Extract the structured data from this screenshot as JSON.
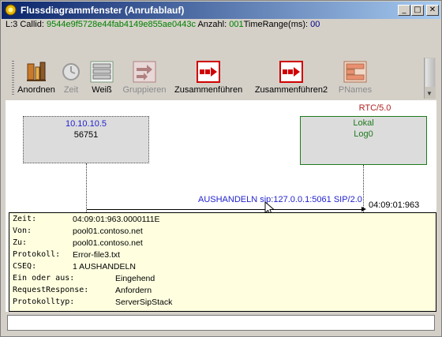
{
  "window": {
    "title": "Flussdiagrammfenster (Anrufablauf)",
    "controls": {
      "minimize": "_",
      "maximize": "□",
      "close": "✕"
    }
  },
  "info": {
    "prefix": "L:3 Callid: ",
    "callid": "9544e9f5728e44fab4149e855ae0443c",
    "count_label": " Anzahl: ",
    "count": "001",
    "time_label": "TimeRange(ms): ",
    "time": "00"
  },
  "toolbar": {
    "items": [
      {
        "label": "Anordnen",
        "icon": "arrange-icon",
        "enabled": true
      },
      {
        "label": "Zeit",
        "icon": "clock-icon",
        "enabled": false
      },
      {
        "label": "Weiß",
        "icon": "white-layout-icon",
        "enabled": true
      },
      {
        "label": "Gruppieren",
        "icon": "group-icon",
        "enabled": false
      },
      {
        "label": "Zusammenführen",
        "icon": "merge-icon",
        "enabled": true
      },
      {
        "label": "Zusammenführen2",
        "icon": "merge2-icon",
        "enabled": true
      },
      {
        "label": "PNames",
        "icon": "pnames-icon",
        "enabled": false
      }
    ]
  },
  "diagram": {
    "rtc_label": "RTC/5.0",
    "left_node": {
      "ip": "10.10.10.5",
      "port": "56751"
    },
    "right_node": {
      "line1": "Lokal",
      "line2": "Log0"
    },
    "message": {
      "label": "AUSHANDELN sip:127.0.0.1:5061 SIP/2.0",
      "time": "04:09:01:963"
    }
  },
  "details": {
    "rows": [
      {
        "key": "Zeit:",
        "value": "04:09:01:963.0000111E"
      },
      {
        "key": "Von:",
        "value": "pool01.contoso.net"
      },
      {
        "key": "Zu:",
        "value": "pool01.contoso.net"
      },
      {
        "key": "Protokoll:",
        "value": "Error-file3.txt"
      },
      {
        "key": "CSEQ:",
        "value": "1 AUSHANDELN"
      },
      {
        "key": "Ein oder aus:",
        "value": "Eingehend"
      },
      {
        "key": "RequestResponse:",
        "value": "Anfordern"
      },
      {
        "key": "Protokolltyp:",
        "value": "ServerSipStack"
      }
    ]
  },
  "colors": {
    "titlebar_start": "#0a246a",
    "callid": "#008000",
    "rtc": "#b22222",
    "message": "#1f1fcf",
    "details_bg": "#ffffe0",
    "right_node_border": "#1f7a1f"
  },
  "status": {
    "value": ""
  }
}
